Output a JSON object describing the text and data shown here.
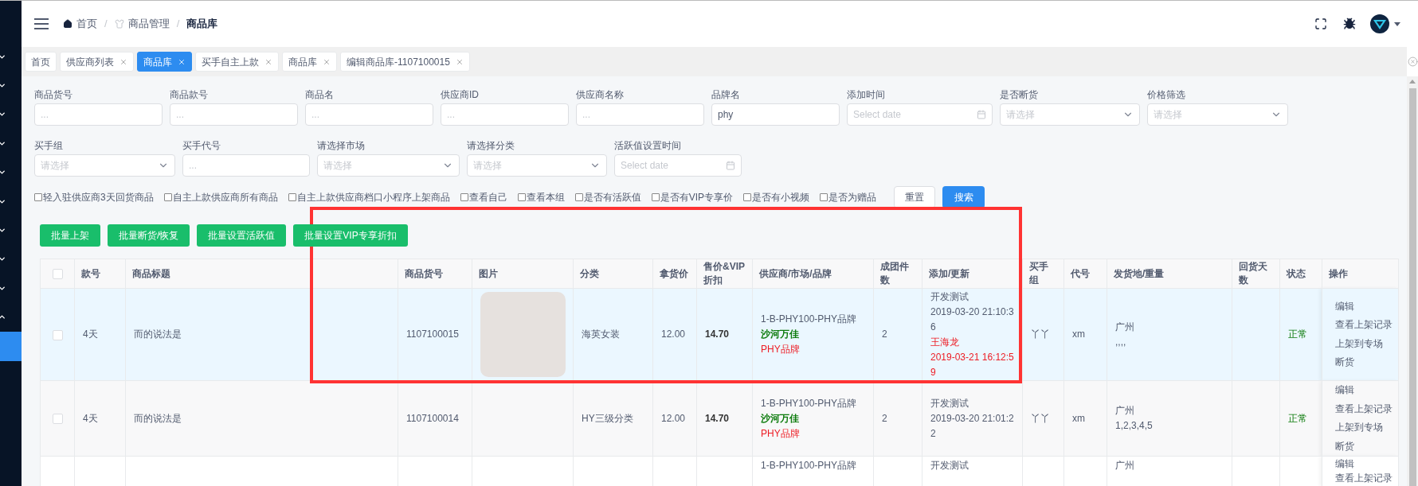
{
  "sidebar": {
    "items": [
      {
        "expanded": false
      },
      {
        "expanded": false
      },
      {
        "expanded": false
      },
      {
        "expanded": false
      },
      {
        "expanded": false
      },
      {
        "expanded": false
      },
      {
        "expanded": false
      },
      {
        "expanded": false
      },
      {
        "expanded": false
      },
      {
        "expanded": true,
        "children": [
          {
            "selected": true
          }
        ]
      }
    ]
  },
  "breadcrumb": [
    {
      "label": "首页",
      "current": false
    },
    {
      "label": "商品管理",
      "current": false
    },
    {
      "label": "商品库",
      "current": true
    }
  ],
  "breadcrumb_separator": "/",
  "tabs": [
    {
      "label": "首页",
      "selected": false,
      "closable": false
    },
    {
      "label": "供应商列表",
      "selected": false,
      "closable": true
    },
    {
      "label": "商品库",
      "selected": true,
      "closable": true
    },
    {
      "label": "买手自主上款",
      "selected": false,
      "closable": true
    },
    {
      "label": "商品库",
      "selected": false,
      "closable": true
    },
    {
      "label": "编辑商品库-1107100015",
      "selected": false,
      "closable": true
    }
  ],
  "filters": [
    [
      {
        "label": "商品货号",
        "kind": "text",
        "placeholder": "..."
      },
      {
        "label": "商品款号",
        "kind": "text",
        "placeholder": "..."
      },
      {
        "label": "商品名",
        "kind": "text",
        "placeholder": "..."
      },
      {
        "label": "供应商ID",
        "kind": "text",
        "placeholder": "..."
      },
      {
        "label": "供应商名称",
        "kind": "text",
        "placeholder": "..."
      },
      {
        "label": "品牌名",
        "kind": "text",
        "value": "phy"
      },
      {
        "label": "添加时间",
        "kind": "date",
        "placeholder": "Select date"
      },
      {
        "label": "是否断货",
        "kind": "select",
        "placeholder": "请选择"
      },
      {
        "label": "价格筛选",
        "kind": "select",
        "placeholder": "请选择"
      }
    ],
    [
      {
        "label": "买手组",
        "kind": "select",
        "placeholder": "请选择"
      },
      {
        "label": "买手代号",
        "kind": "text",
        "placeholder": "..."
      },
      {
        "label": "请选择市场",
        "kind": "select",
        "placeholder": "请选择"
      },
      {
        "label": "请选择分类",
        "kind": "select",
        "placeholder": "请选择"
      },
      {
        "label": "活跃值设置时间",
        "kind": "date",
        "placeholder": "Select date"
      }
    ]
  ],
  "checkboxes": [
    {
      "label": "轻入驻供应商3天回货商品",
      "checked": false
    },
    {
      "label": "自主上款供应商所有商品",
      "checked": false
    },
    {
      "label": "自主上款供应商档口小程序上架商品",
      "checked": false
    },
    {
      "label": "查看自己",
      "checked": false
    },
    {
      "label": "查看本组",
      "checked": false
    },
    {
      "label": "是否有活跃值",
      "checked": false
    },
    {
      "label": "是否有VIP专享价",
      "checked": false
    },
    {
      "label": "是否有小视频",
      "checked": false
    },
    {
      "label": "是否为赠品",
      "checked": false
    }
  ],
  "reset_button": "重置",
  "search_button": "搜索",
  "bulk_actions": [
    "批量上架",
    "批量断货/恢复",
    "批量设置活跃值",
    "批量设置VIP专享折扣"
  ],
  "table": {
    "select_all_checked": false,
    "columns": [
      "款号",
      "商品标题",
      "商品货号",
      "图片",
      "分类",
      "拿货价",
      "售价&VIP折扣",
      "供应商/市场/品牌",
      "成团件数",
      "添加/更新",
      "买手组",
      "代号",
      "发货地/重量",
      "回货天数",
      "状态",
      "操作"
    ],
    "rows": [
      {
        "selected": true,
        "checked": false,
        "style_no": "4天",
        "title": "而的说法是",
        "sku": "1107100015",
        "has_image": true,
        "category": "海英女装",
        "cost": "12.00",
        "price": "14.70",
        "supplier": "1-B-PHY100-PHY品牌",
        "market": "沙河万佳",
        "brand": "PHY品牌",
        "group_qty": "2",
        "creator": "开发测试",
        "created": "2019-03-20 21:10:36",
        "updater": "王海龙",
        "updated": "2019-03-21 16:12:59",
        "buyer_group": "丫丫",
        "buyer_code": "xm",
        "city": "广州",
        "weight": ",,,,",
        "status": "正常",
        "actions": [
          "编辑",
          "查看上架记录",
          "上架到专场",
          "断货"
        ]
      },
      {
        "selected": false,
        "checked": false,
        "style_no": "4天",
        "title": "而的说法是",
        "sku": "1107100014",
        "has_image": false,
        "category": "HY三级分类",
        "cost": "12.00",
        "price": "14.70",
        "supplier": "1-B-PHY100-PHY品牌",
        "market": "沙河万佳",
        "brand": "PHY品牌",
        "group_qty": "2",
        "creator": "开发测试",
        "created": "2019-03-20 21:01:22",
        "buyer_group": "丫丫",
        "buyer_code": "xm",
        "city": "广州",
        "weight": "1,2,3,4,5",
        "status": "正常",
        "actions": [
          "编辑",
          "查看上架记录",
          "上架到专场",
          "断货"
        ]
      },
      {
        "selected": false,
        "supplier": "1-B-PHY100-PHY品牌",
        "creator": "开发测试",
        "city": "广州",
        "actions": [
          "编辑",
          "查看上架记录"
        ]
      }
    ]
  }
}
